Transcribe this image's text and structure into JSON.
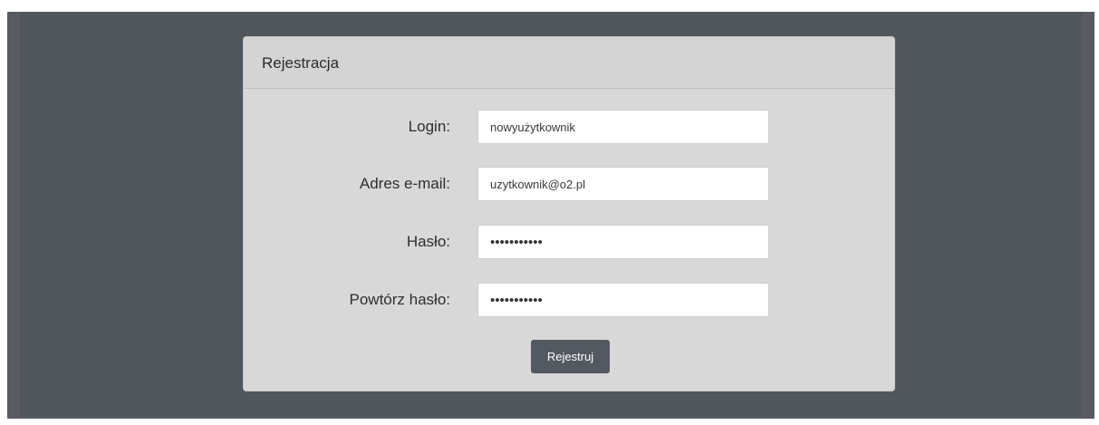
{
  "form": {
    "title": "Rejestracja",
    "fields": [
      {
        "label": "Login:",
        "value": "nowyużytkownik",
        "type": "text"
      },
      {
        "label": "Adres e-mail:",
        "value": "uzytkownik@o2.pl",
        "type": "text"
      },
      {
        "label": "Hasło:",
        "value": "•••••••••••",
        "type": "password"
      },
      {
        "label": "Powtórz hasło:",
        "value": "•••••••••••",
        "type": "password"
      }
    ],
    "submit_label": "Rejestruj"
  }
}
